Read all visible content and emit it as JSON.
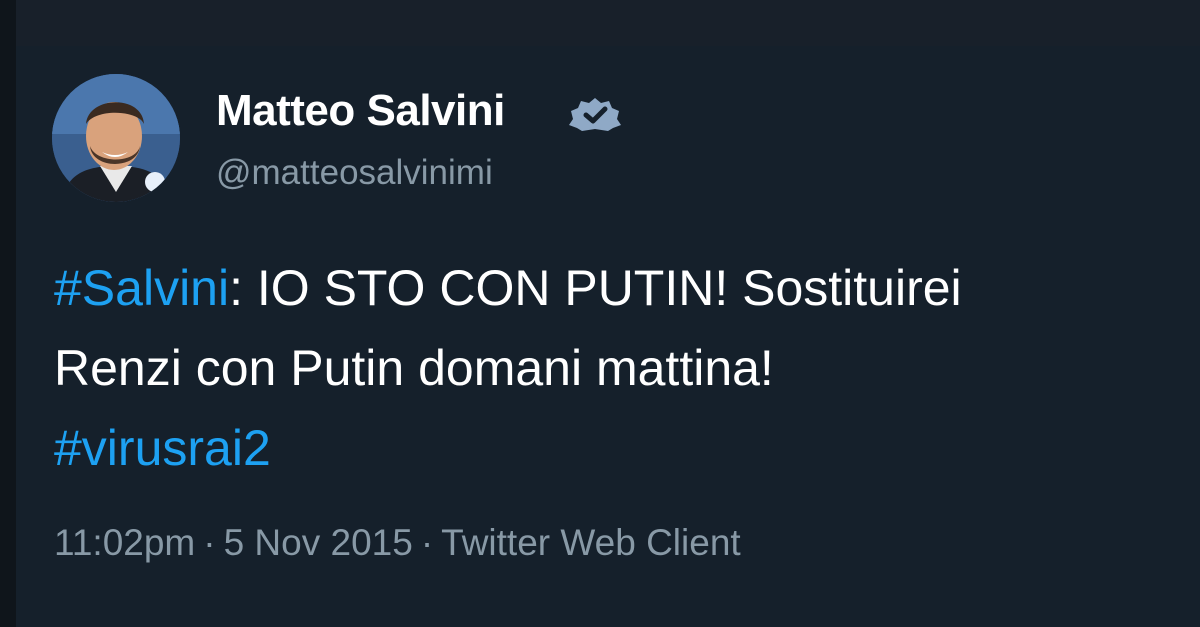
{
  "user": {
    "display_name": "Matteo Salvini",
    "handle": "@matteosalvinimi",
    "verified_icon": "verified-badge-icon"
  },
  "tweet": {
    "hashtag_1": "#Salvini",
    "text_line1_rest": ": IO STO CON PUTIN! Sostituirei",
    "text_line2": "Renzi con Putin domani mattina!",
    "hashtag_2": "#virusrai2"
  },
  "meta": {
    "time": "11:02pm",
    "separator": "·",
    "date": "5 Nov 2015",
    "source": "Twitter Web Client"
  },
  "colors": {
    "background": "#15202b",
    "text": "#ffffff",
    "hashtag": "#1da1f2",
    "secondary": "#8899a6"
  }
}
